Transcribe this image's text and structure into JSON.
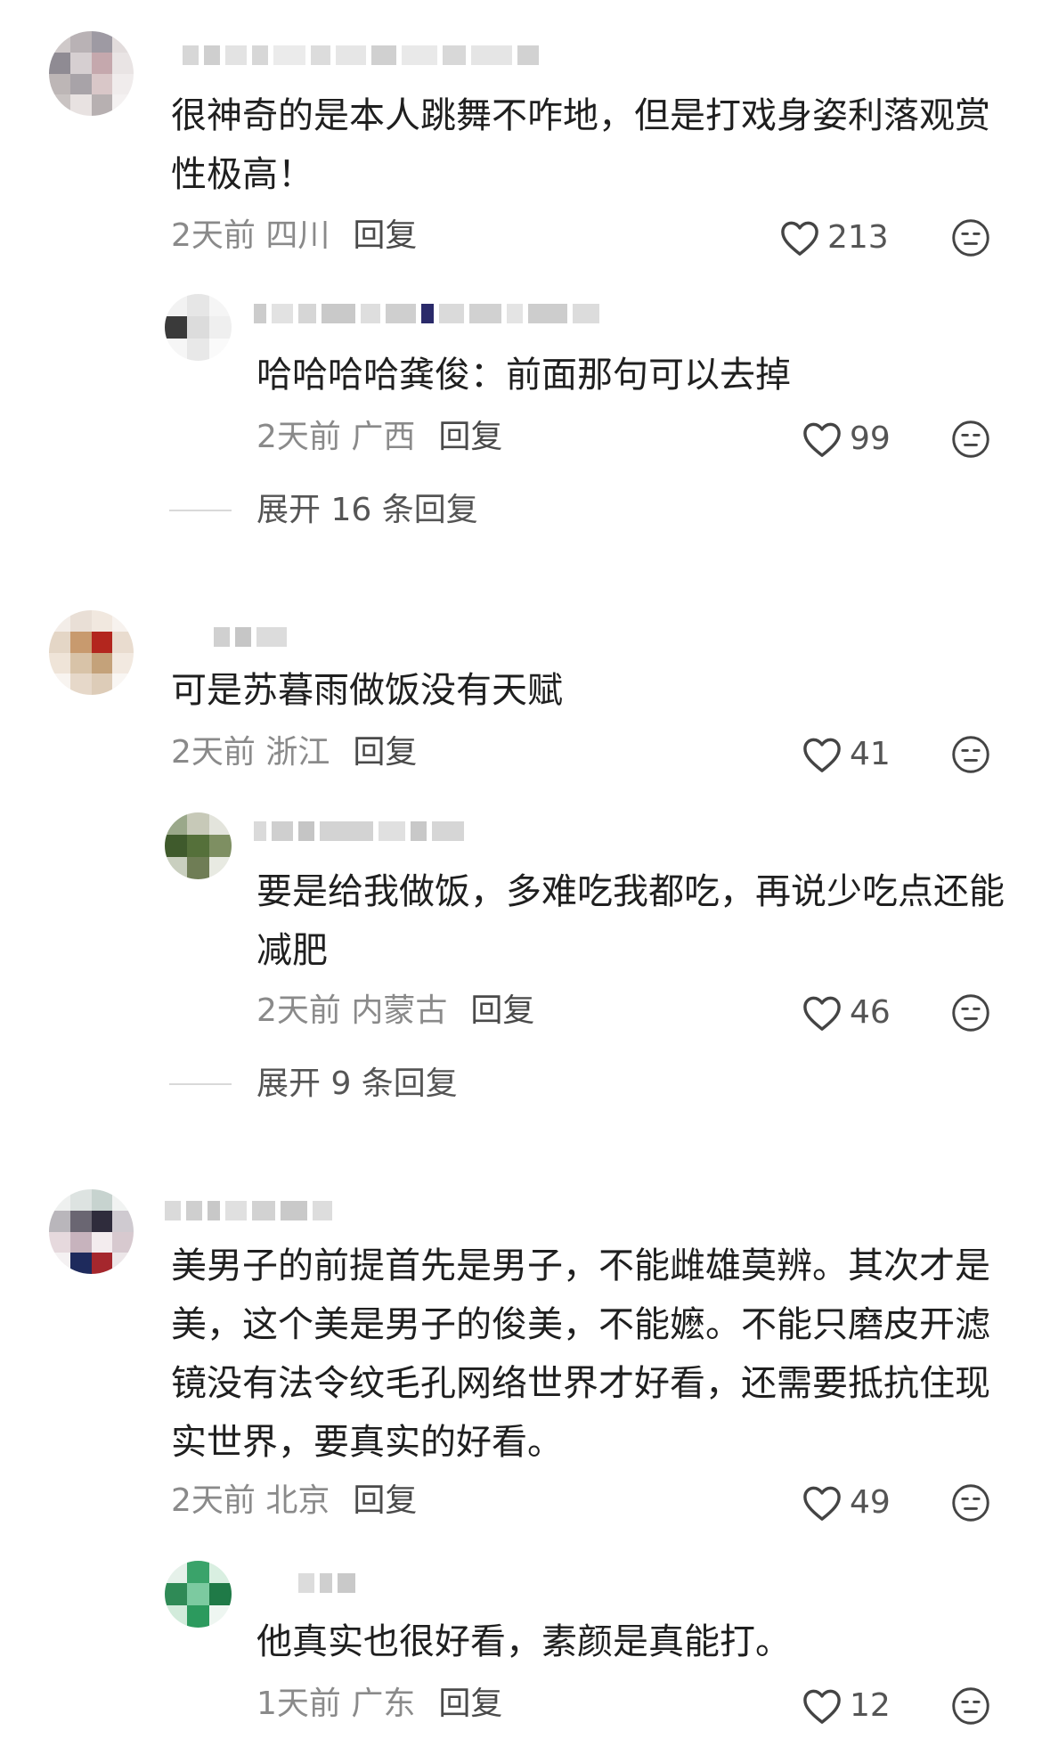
{
  "comments": [
    {
      "text": "很神奇的是本人跳舞不咋地，但是打戏身姿利落观赏性极高！",
      "time": "2天前",
      "region": "四川",
      "reply_label": "回复",
      "likes": "213",
      "replies": [
        {
          "text": "哈哈哈哈龚俊：前面那句可以去掉",
          "time": "2天前",
          "region": "广西",
          "reply_label": "回复",
          "likes": "99"
        }
      ],
      "expand_label": "展开 16 条回复"
    },
    {
      "text": "可是苏暮雨做饭没有天赋",
      "time": "2天前",
      "region": "浙江",
      "reply_label": "回复",
      "likes": "41",
      "replies": [
        {
          "text": "要是给我做饭，多难吃我都吃，再说少吃点还能减肥",
          "time": "2天前",
          "region": "内蒙古",
          "reply_label": "回复",
          "likes": "46"
        }
      ],
      "expand_label": "展开 9 条回复"
    },
    {
      "text": "美男子的前提首先是男子，不能雌雄莫辨。其次才是美，这个美是男子的俊美，不能嬷。不能只磨皮开滤镜没有法令纹毛孔网络世界才好看，还需要抵抗住现实世界，要真实的好看。",
      "time": "2天前",
      "region": "北京",
      "reply_label": "回复",
      "likes": "49",
      "replies": [
        {
          "text": "他真实也很好看，素颜是真能打。",
          "time": "1天前",
          "region": "广东",
          "reply_label": "回复",
          "likes": "12"
        }
      ]
    }
  ],
  "icons": {
    "like": "heart-outline-icon",
    "dislike": "unamused-face-icon"
  },
  "colors": {
    "text": "#1f1f1f",
    "meta": "#8a8a8a",
    "reply": "#4a4a4a",
    "background": "#ffffff"
  }
}
